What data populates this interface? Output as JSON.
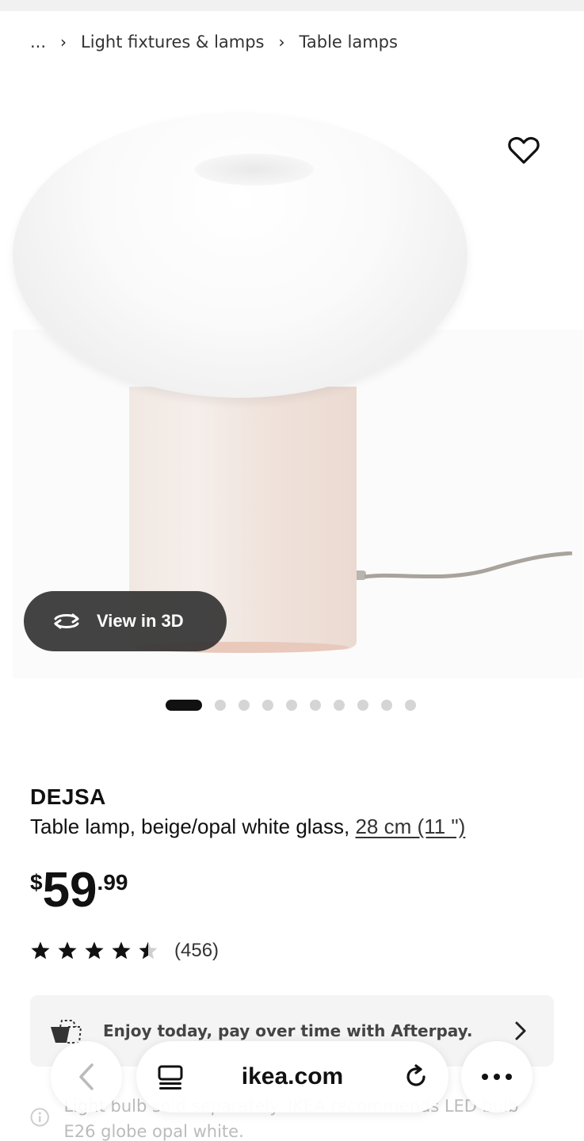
{
  "breadcrumb": {
    "ellipsis": "...",
    "items": [
      "Light fixtures & lamps",
      "Table lamps"
    ]
  },
  "gallery": {
    "view_3d_label": "View in 3D",
    "total_images": 10,
    "active_index": 0,
    "icons": {
      "favorite": "heart-outline-icon",
      "view3d": "rotate-arrows-icon"
    }
  },
  "product": {
    "name": "DEJSA",
    "description": "Table lamp, beige/opal white glass, ",
    "size_link": "28 cm (11 \")",
    "price": {
      "currency": "$",
      "integer": "59",
      "decimal": ".99"
    },
    "rating": {
      "value": 4.5,
      "max": 5,
      "count_label": "(456)"
    }
  },
  "afterpay": {
    "text": "Enjoy today, pay over time with Afterpay.",
    "icon": "afterpay-bag-icon"
  },
  "notice": {
    "text": "Light bulb sold separately. IKEA recommends LED bulb E26 globe opal white."
  },
  "browser": {
    "domain": "ikea.com",
    "icons": [
      "back-icon",
      "tabs-icon",
      "reload-icon",
      "more-icon"
    ]
  },
  "colors": {
    "text": "#111111",
    "pill_bg": "#333333",
    "afterpay_bg": "#f4f4f4",
    "dot_inactive": "#d5d5d5"
  }
}
